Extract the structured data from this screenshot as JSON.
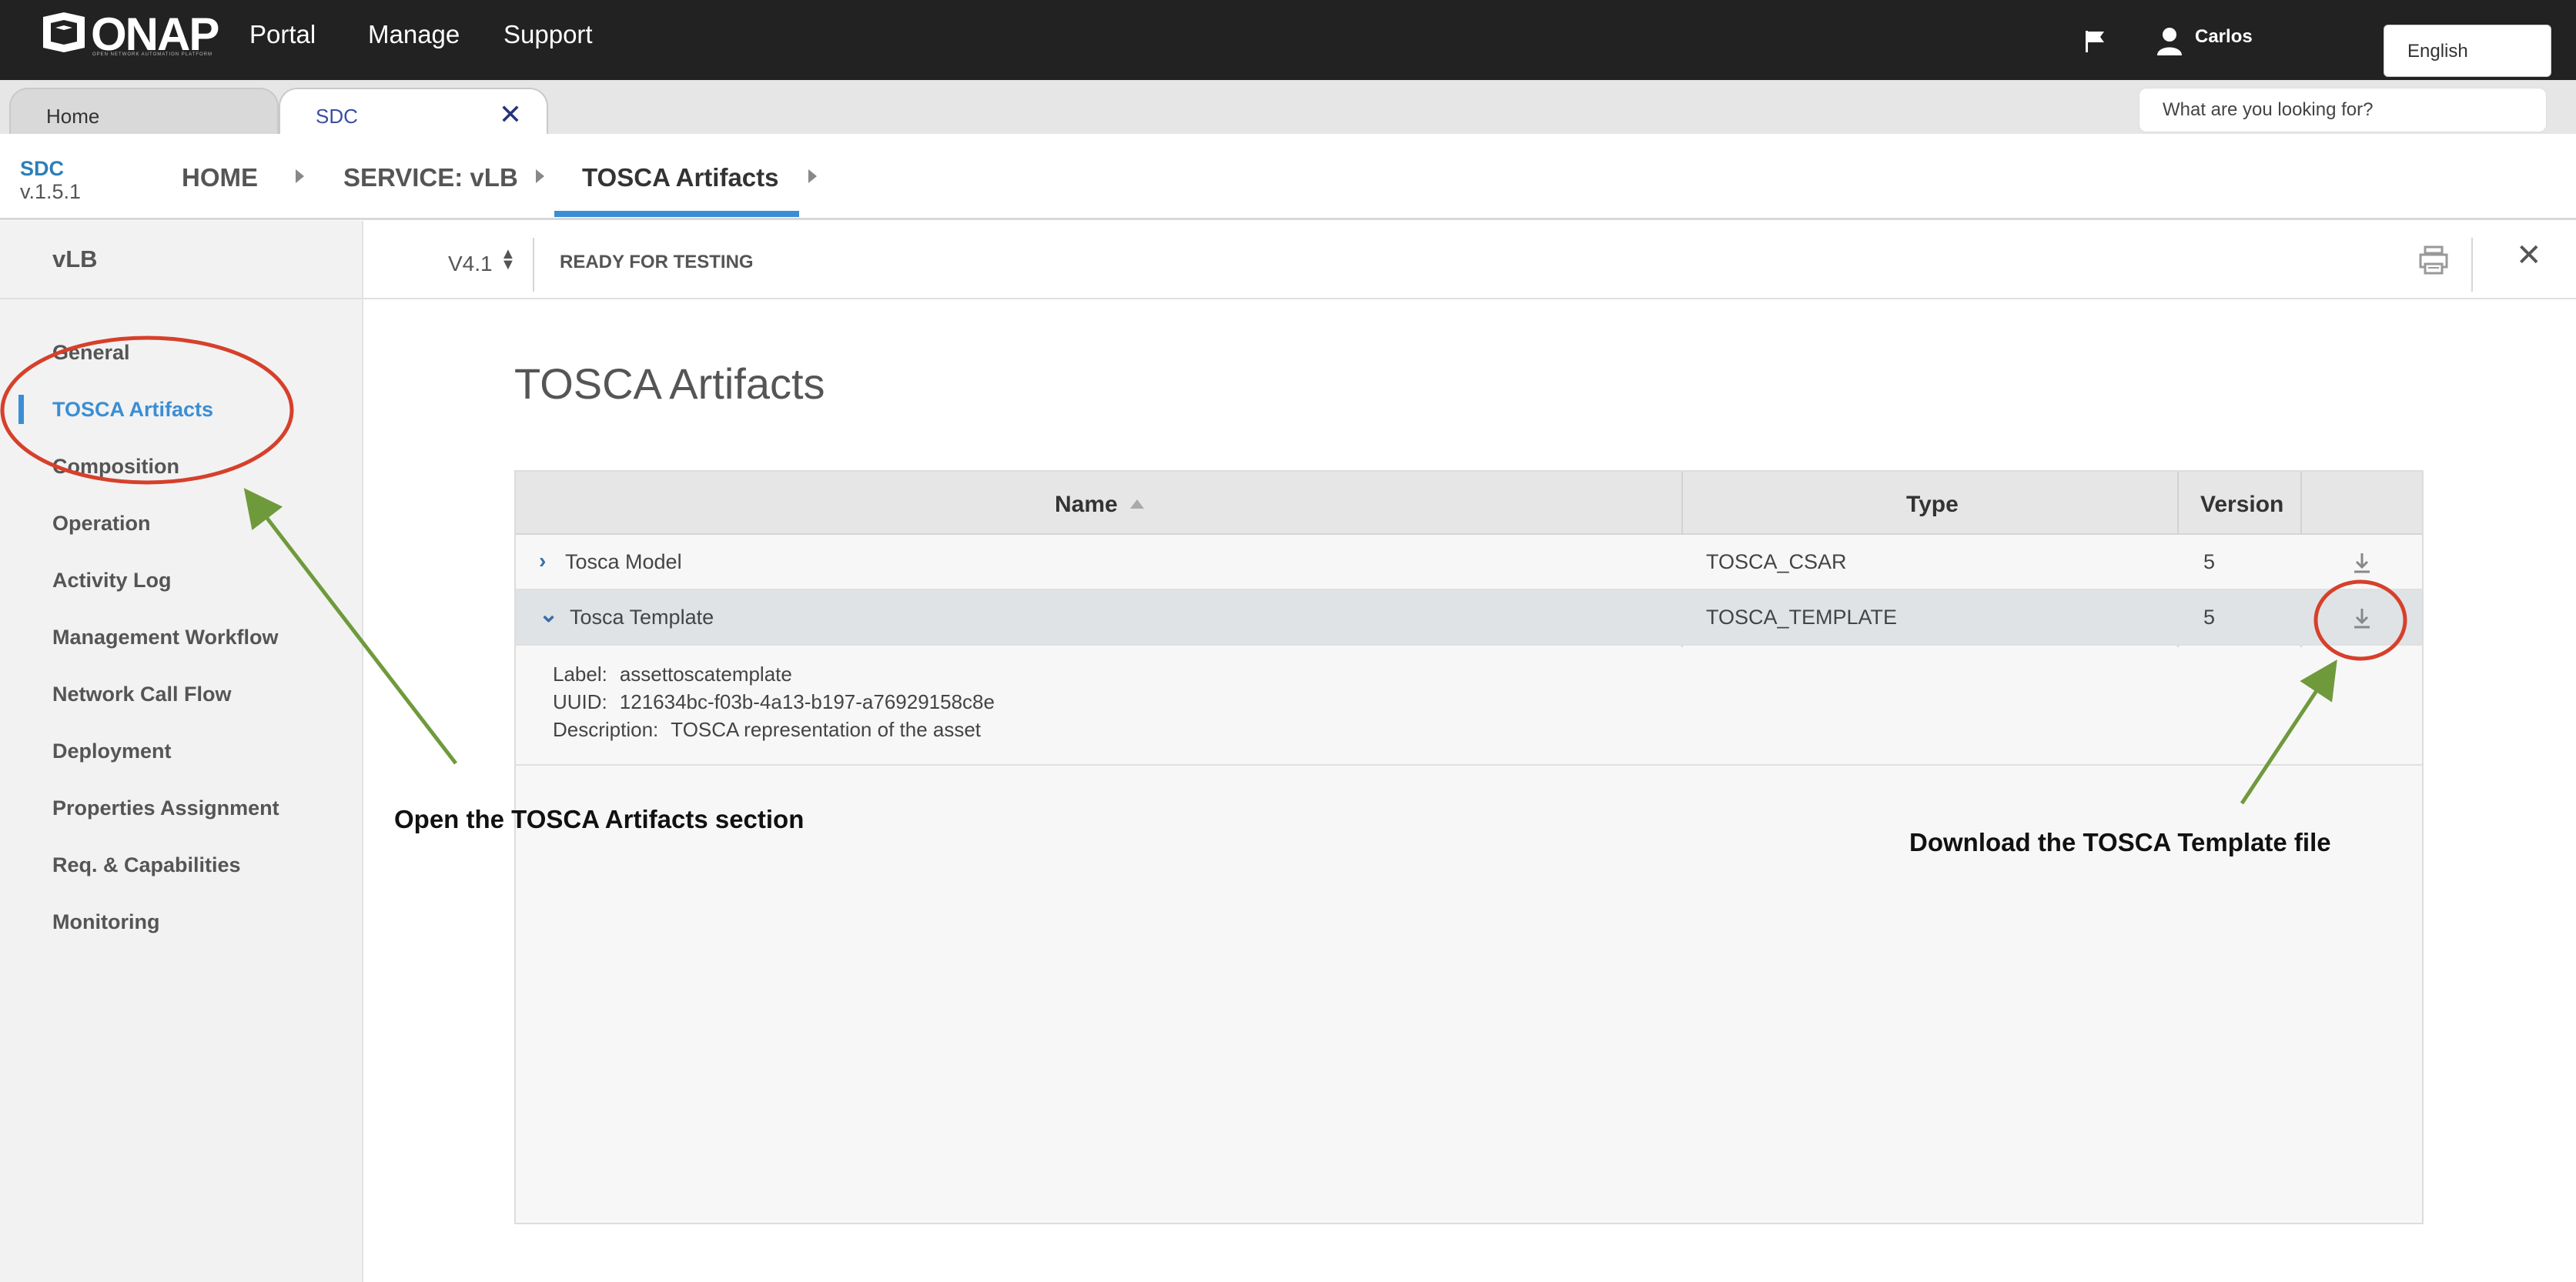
{
  "topbar": {
    "logo_text": "ONAP",
    "logo_subtext": "OPEN NETWORK AUTOMATION PLATFORM",
    "nav": [
      "Portal",
      "Manage",
      "Support"
    ],
    "user_name": "Carlos",
    "language": "English"
  },
  "tabs": {
    "home_label": "Home",
    "sdc_label": "SDC",
    "search_placeholder": "What are you looking for?"
  },
  "breadcrumb": {
    "app_name": "SDC",
    "app_version": "v.1.5.1",
    "items": [
      "HOME",
      "SERVICE: vLB",
      "TOSCA Artifacts"
    ]
  },
  "sidebar": {
    "title": "vLB",
    "items": [
      "General",
      "TOSCA Artifacts",
      "Composition",
      "Operation",
      "Activity Log",
      "Management Workflow",
      "Network Call Flow",
      "Deployment",
      "Properties Assignment",
      "Req. & Capabilities",
      "Monitoring"
    ],
    "active_item": "TOSCA Artifacts"
  },
  "header": {
    "version": "V4.1",
    "status": "READY FOR TESTING"
  },
  "main": {
    "title": "TOSCA Artifacts",
    "columns": [
      "Name",
      "Type",
      "Version"
    ],
    "rows": [
      {
        "name": "Tosca Model",
        "type": "TOSCA_CSAR",
        "version": "5",
        "expanded": false
      },
      {
        "name": "Tosca Template",
        "type": "TOSCA_TEMPLATE",
        "version": "5",
        "expanded": true
      }
    ],
    "details": {
      "label_key": "Label:",
      "label_value": "assettoscatemplate",
      "uuid_key": "UUID:",
      "uuid_value": "121634bc-f03b-4a13-b197-a76929158c8e",
      "description_key": "Description:",
      "description_value": "TOSCA representation of the asset"
    }
  },
  "annotations": {
    "left": "Open the TOSCA Artifacts section",
    "right": "Download the TOSCA Template file",
    "circle_color": "#d6402b",
    "arrow_color": "#6f9a3c"
  },
  "colors": {
    "accent": "#3b8ed4",
    "topbar": "#222222"
  }
}
